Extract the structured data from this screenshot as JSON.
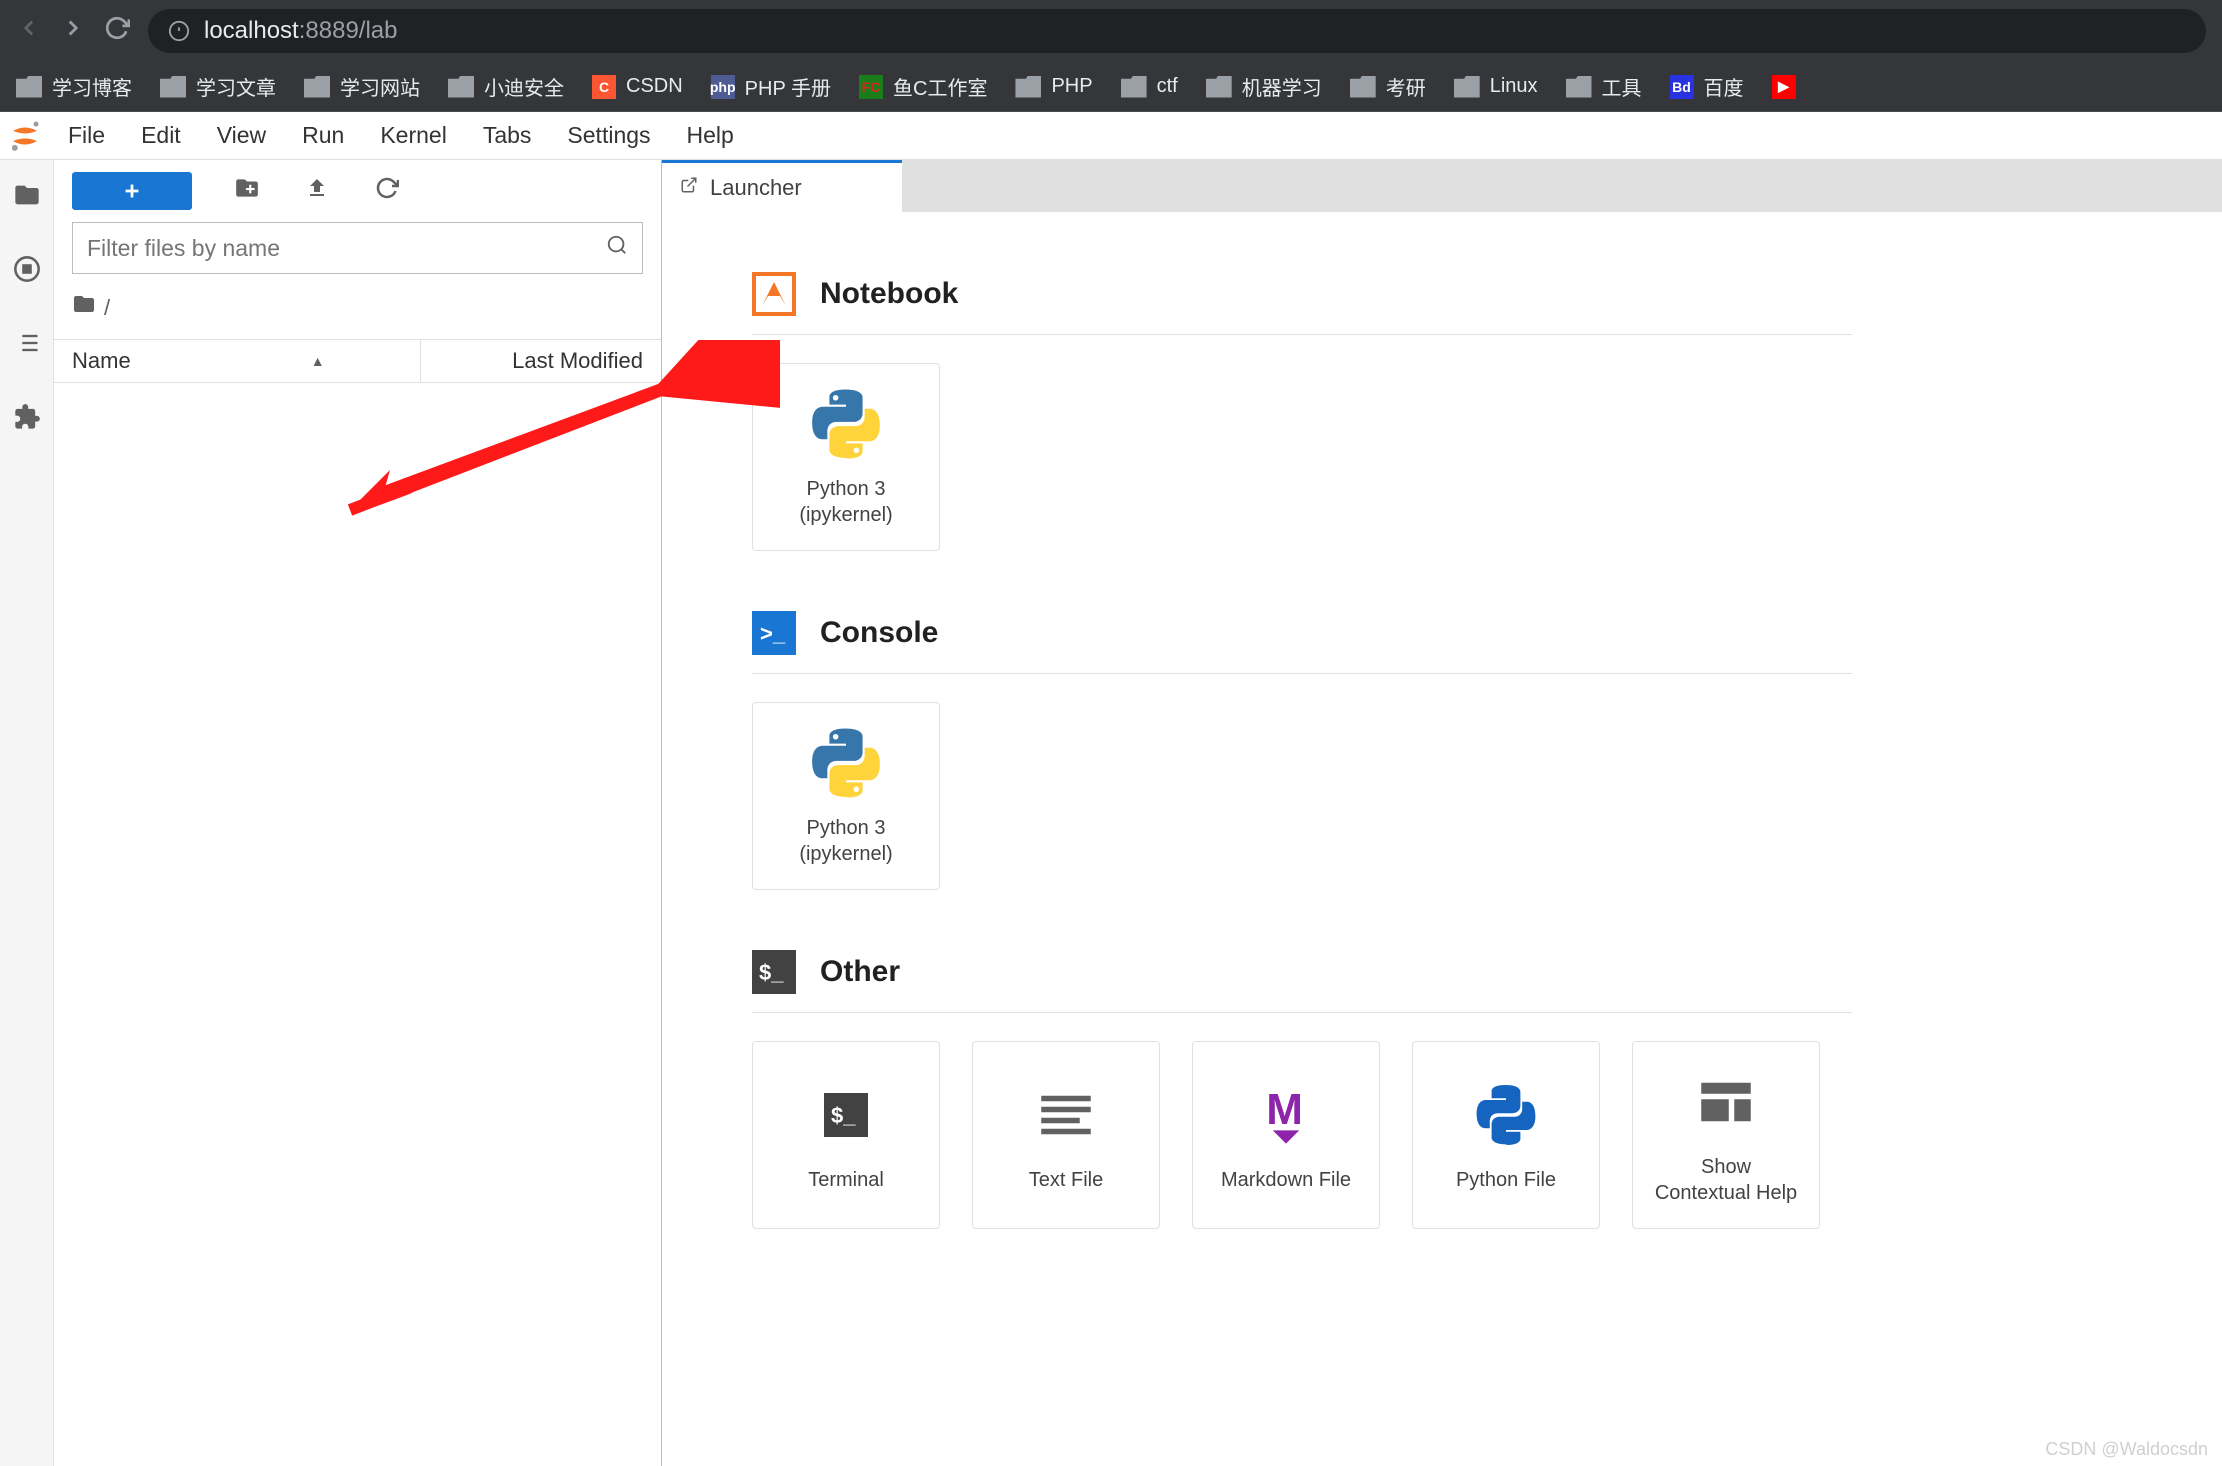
{
  "browser": {
    "url_prefix": "localhost",
    "url_suffix": ":8889/lab",
    "bookmarks": [
      {
        "type": "folder",
        "label": "学习博客"
      },
      {
        "type": "folder",
        "label": "学习文章"
      },
      {
        "type": "folder",
        "label": "学习网站"
      },
      {
        "type": "folder",
        "label": "小迪安全"
      },
      {
        "type": "favicon",
        "label": "CSDN",
        "icon_bg": "#fc5531",
        "icon_fg": "#fff",
        "icon_text": "C"
      },
      {
        "type": "favicon",
        "label": "PHP 手册",
        "icon_bg": "#4F5B93",
        "icon_fg": "#fff",
        "icon_text": "php"
      },
      {
        "type": "favicon",
        "label": "鱼C工作室",
        "icon_bg": "#1a7d1a",
        "icon_fg": "#d22",
        "icon_text": "FC"
      },
      {
        "type": "folder",
        "label": "PHP"
      },
      {
        "type": "folder",
        "label": "ctf"
      },
      {
        "type": "folder",
        "label": "机器学习"
      },
      {
        "type": "folder",
        "label": "考研"
      },
      {
        "type": "folder",
        "label": "Linux"
      },
      {
        "type": "folder",
        "label": "工具"
      },
      {
        "type": "favicon",
        "label": "百度",
        "icon_bg": "#2932e1",
        "icon_fg": "#fff",
        "icon_text": "Bd"
      }
    ]
  },
  "menubar": [
    "File",
    "Edit",
    "View",
    "Run",
    "Kernel",
    "Tabs",
    "Settings",
    "Help"
  ],
  "filebrowser": {
    "filter_placeholder": "Filter files by name",
    "breadcrumb_root": "/",
    "header_name": "Name",
    "header_modified": "Last Modified"
  },
  "tab": {
    "title": "Launcher"
  },
  "launcher": {
    "sections": [
      {
        "title": "Notebook",
        "icon": "notebook",
        "cards": [
          {
            "icon": "python",
            "label": "Python 3\n(ipykernel)"
          }
        ]
      },
      {
        "title": "Console",
        "icon": "console",
        "cards": [
          {
            "icon": "python",
            "label": "Python 3\n(ipykernel)"
          }
        ]
      },
      {
        "title": "Other",
        "icon": "terminal",
        "cards": [
          {
            "icon": "terminal",
            "label": "Terminal"
          },
          {
            "icon": "textfile",
            "label": "Text File"
          },
          {
            "icon": "markdown",
            "label": "Markdown File"
          },
          {
            "icon": "pythonfile",
            "label": "Python File"
          },
          {
            "icon": "help",
            "label": "Show\nContextual Help"
          }
        ]
      }
    ]
  },
  "watermark": "CSDN @Waldocsdn"
}
